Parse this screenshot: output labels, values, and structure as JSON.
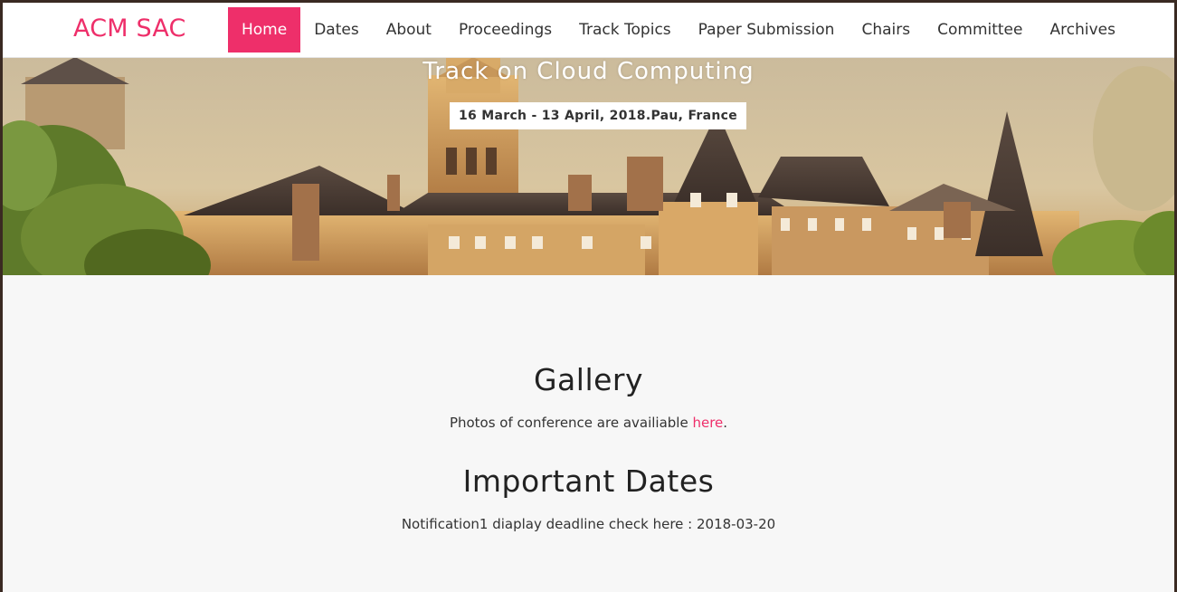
{
  "brand": {
    "name": "ACM SAC",
    "color": "#ee2f6a"
  },
  "nav": {
    "items": [
      {
        "label": "Home",
        "active": true
      },
      {
        "label": "Dates"
      },
      {
        "label": "About"
      },
      {
        "label": "Proceedings"
      },
      {
        "label": "Track Topics"
      },
      {
        "label": "Paper Submission"
      },
      {
        "label": "Chairs"
      },
      {
        "label": "Committee"
      },
      {
        "label": "Archives"
      }
    ]
  },
  "hero": {
    "title": "Track on Cloud Computing",
    "dates": "16 March - 13 April, 2018.Pau, France"
  },
  "gallery": {
    "title": "Gallery",
    "text_before": "Photos of conference are availiable ",
    "link_label": "here",
    "text_after": "."
  },
  "important_dates": {
    "title": "Important Dates",
    "text": "Notification1 diaplay deadline check here : 2018-03-20"
  }
}
